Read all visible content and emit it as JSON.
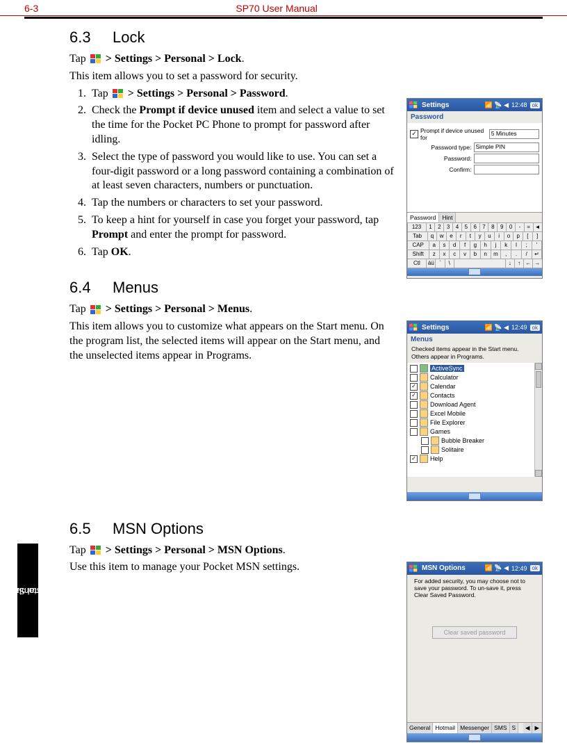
{
  "header": {
    "left": "6-3",
    "center": "SP70 User Manual"
  },
  "sideband": {
    "line1": "Customizing",
    "line2": "Personal Settings"
  },
  "sec63": {
    "num": "6.3",
    "title": "Lock",
    "tap_prefix": "Tap ",
    "tap_path": " > Settings > Personal > Lock",
    "tap_suffix": ".",
    "desc": "This item allows you to set a password for security.",
    "steps": [
      {
        "pre": "Tap ",
        "bold": " > Settings > Personal > Password",
        "post": "."
      },
      {
        "pre": "Check the ",
        "bold": "Prompt if device unused",
        "post": " item and select a value to set the time for the Pocket PC Phone to prompt for password after idling."
      },
      {
        "pre": "Select the type of password you would like to use. You can set a four-digit password or a long password containing a combination of at least seven characters, numbers or punctuation.",
        "bold": "",
        "post": ""
      },
      {
        "pre": "Tap the numbers or characters to set your password.",
        "bold": "",
        "post": ""
      },
      {
        "pre": "To keep a hint for yourself in case you forget your password, tap ",
        "bold": "Prompt",
        "post": " and enter the prompt for password."
      },
      {
        "pre": "Tap ",
        "bold": "OK",
        "post": "."
      }
    ]
  },
  "sec64": {
    "num": "6.4",
    "title": "Menus",
    "tap_prefix": "Tap ",
    "tap_path": " > Settings > Personal > Menus",
    "tap_suffix": ".",
    "desc": "This item allows you to customize what appears on the Start menu. On the program list, the selected items will appear on the Start menu, and the unselected items appear in Programs."
  },
  "sec65": {
    "num": "6.5",
    "title": "MSN Options",
    "tap_prefix": "Tap ",
    "tap_path": " > Settings > Personal > MSN Options",
    "tap_suffix": ".",
    "desc": "Use this item to manage your Pocket MSN settings."
  },
  "shot1": {
    "title": "Settings",
    "time": "12:48",
    "ok": "ok",
    "subhead": "Password",
    "prompt_chk": "✓",
    "prompt_lbl": "Prompt if device unused for",
    "prompt_val": "5 Minutes",
    "pwdtype_lbl": "Password type:",
    "pwdtype_val": "Simple PIN",
    "pwd_lbl": "Password:",
    "confirm_lbl": "Confirm:",
    "tab1": "Password",
    "tab2": "Hint",
    "kbd": {
      "r0": [
        "123",
        "1",
        "2",
        "3",
        "4",
        "5",
        "6",
        "7",
        "8",
        "9",
        "0",
        "-",
        "=",
        "◄"
      ],
      "r1": [
        "Tab",
        "q",
        "w",
        "e",
        "r",
        "t",
        "y",
        "u",
        "i",
        "o",
        "p",
        "[",
        "]"
      ],
      "r2": [
        "CAP",
        "a",
        "s",
        "d",
        "f",
        "g",
        "h",
        "j",
        "k",
        "l",
        ";",
        "'"
      ],
      "r3": [
        "Shift",
        "z",
        "x",
        "c",
        "v",
        "b",
        "n",
        "m",
        ",",
        ".",
        "/",
        "↵"
      ],
      "r4": [
        "Ctl",
        "áü",
        "`",
        "\\",
        " ",
        "↓",
        "↑",
        "←",
        "→"
      ]
    }
  },
  "shot2": {
    "title": "Settings",
    "time": "12:49",
    "ok": "ok",
    "subhead": "Menus",
    "note": "Checked items appear in the Start menu. Others appear in Programs.",
    "items": [
      {
        "chk": "",
        "label": "ActiveSync",
        "selected": true
      },
      {
        "chk": "",
        "label": "Calculator"
      },
      {
        "chk": "✓",
        "label": "Calendar"
      },
      {
        "chk": "✓",
        "label": "Contacts"
      },
      {
        "chk": "",
        "label": "Download Agent"
      },
      {
        "chk": "",
        "label": "Excel Mobile"
      },
      {
        "chk": "",
        "label": "File Explorer"
      },
      {
        "chk": "",
        "label": "Games"
      },
      {
        "chk": "",
        "label": "Bubble Breaker",
        "indent": true
      },
      {
        "chk": "",
        "label": "Solitaire",
        "indent": true
      },
      {
        "chk": "✓",
        "label": "Help"
      }
    ]
  },
  "shot3": {
    "title": "MSN Options",
    "time": "12:49",
    "ok": "ok",
    "note": "For added security, you may choose not to save your password. To un-save it, press Clear Saved Password.",
    "btn": "Clear saved password",
    "tabs": [
      "General",
      "Hotmail",
      "Messenger",
      "SMS",
      "S"
    ],
    "active_tab": 1
  }
}
